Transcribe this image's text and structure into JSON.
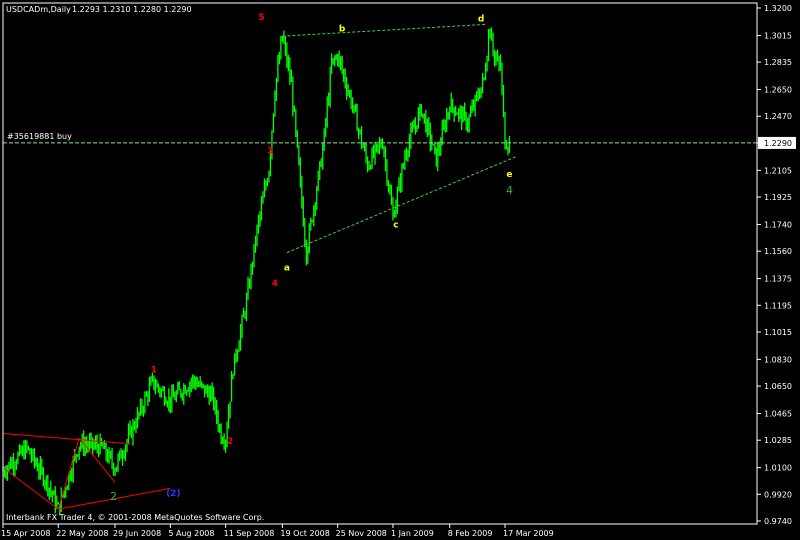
{
  "header": {
    "symbol": "USDCADm,Daily",
    "ohlc": "1.2293 1.2310 1.2280 1.2290"
  },
  "footer": {
    "copyright": "Interbank FX Trader 4, © 2001-2008 MetaQuotes Software Corp."
  },
  "order_line": {
    "label": "#35619881 buy",
    "price": 1.229,
    "color": "#8ee28e"
  },
  "current_price": {
    "label": "1.2290",
    "value": 1.229
  },
  "colors": {
    "background": "#000000",
    "candles": "#00ff00",
    "frame": "#ffffff",
    "red": "#ff0000",
    "yellow": "#ffff00",
    "wave_green": "#2db52d",
    "blue": "#1e3cff",
    "triangle_line": "#44cc44"
  },
  "chart_data": {
    "type": "line",
    "title": "USDCADm,Daily",
    "ylim": [
      0.97,
      1.32
    ],
    "y_ticks": [
      "1.3200",
      "1.3015",
      "1.2835",
      "1.2650",
      "1.2470",
      "1.2290",
      "1.2105",
      "1.1925",
      "1.1740",
      "1.1560",
      "1.1375",
      "1.1195",
      "1.1015",
      "1.0830",
      "1.0650",
      "1.0465",
      "1.0285",
      "1.0100",
      "0.9920",
      "0.9740"
    ],
    "x_ticks": [
      "15 Apr 2008",
      "22 May 2008",
      "29 Jun 2008",
      "5 Aug 2008",
      "11 Sep 2008",
      "19 Oct 2008",
      "25 Nov 2008",
      "1 Jan 2009",
      "8 Feb 2009",
      "17 Mar 2009"
    ],
    "series": [
      {
        "x": [
          "15 Apr 2008",
          "1 May 2008",
          "15 May 2008",
          "22 May 2008",
          "5 Jun 2008",
          "20 Jun 2008",
          "29 Jun 2008",
          "15 Jul 2008",
          "24 Jul 2008",
          "5 Aug 2008",
          "20 Aug 2008",
          "2 Sep 2008",
          "8 Sep 2008",
          "11 Sep 2008",
          "16 Sep 2008",
          "25 Sep 2008",
          "2 Oct 2008",
          "10 Oct 2008",
          "14 Oct 2008",
          "19 Oct 2008",
          "25 Oct 2008",
          "4 Nov 2008",
          "15 Nov 2008",
          "21 Nov 2008",
          "25 Nov 2008",
          "5 Dec 2008",
          "15 Dec 2008",
          "25 Dec 2008",
          "1 Jan 2009",
          "10 Jan 2009",
          "20 Jan 2009",
          "30 Jan 2009",
          "8 Feb 2009",
          "20 Feb 2009",
          "3 Mar 2009",
          "7 Mar 2009",
          "10 Mar 2009",
          "14 Mar 2009",
          "17 Mar 2009",
          "20 Mar 2009"
        ],
        "values": [
          1.008,
          1.023,
          0.999,
          0.982,
          1.026,
          1.024,
          1.01,
          1.046,
          1.068,
          1.055,
          1.069,
          1.058,
          1.032,
          1.03,
          1.077,
          1.122,
          1.17,
          1.212,
          1.265,
          1.301,
          1.268,
          1.155,
          1.224,
          1.282,
          1.288,
          1.254,
          1.214,
          1.23,
          1.179,
          1.225,
          1.252,
          1.218,
          1.255,
          1.243,
          1.272,
          1.309,
          1.286,
          1.28,
          1.23,
          1.229
        ]
      }
    ],
    "annotations": [
      {
        "text": "5",
        "color": "red",
        "date": "5 Oct 2008",
        "price": 1.312
      },
      {
        "text": "3",
        "color": "red",
        "date": "11 Oct 2008",
        "price": 1.222
      },
      {
        "text": "4",
        "color": "red",
        "date": "14 Oct 2008",
        "price": 1.1325
      },
      {
        "text": "1",
        "color": "red",
        "date": "25 Jul 2008",
        "price": 1.074
      },
      {
        "text": "2",
        "color": "red",
        "date": "14 Sep 2008",
        "price": 1.026
      },
      {
        "text": "b",
        "color": "yellow",
        "date": "28 Nov 2008",
        "price": 1.304
      },
      {
        "text": "a",
        "color": "yellow",
        "date": "22 Oct 2008",
        "price": 1.143
      },
      {
        "text": "c",
        "color": "yellow",
        "date": "3 Jan 2009",
        "price": 1.172
      },
      {
        "text": "d",
        "color": "yellow",
        "date": "1 Mar 2009",
        "price": 1.311
      },
      {
        "text": "e",
        "color": "yellow",
        "date": "20 Mar 2009",
        "price": 1.206
      },
      {
        "text": "4",
        "color": "green",
        "date": "20 Mar 2009",
        "price": 1.1945
      },
      {
        "text": "2",
        "color": "green",
        "date": "28 Jun 2008",
        "price": 0.988
      },
      {
        "text": "(2)",
        "color": "blue",
        "date": "7 Aug 2008",
        "price": 0.991
      }
    ],
    "trendlines": [
      {
        "color": "green-dashed",
        "from": {
          "date": "19 Oct 2008",
          "price": 1.301
        },
        "to": {
          "date": "5 Mar 2009",
          "price": 1.309
        }
      },
      {
        "color": "green-dashed",
        "from": {
          "date": "22 Oct 2008",
          "price": 1.155
        },
        "to": {
          "date": "25 Mar 2009",
          "price": 1.22
        }
      },
      {
        "color": "red",
        "from": {
          "date": "15 Apr 2008",
          "price": 1.033
        },
        "to": {
          "date": "10 Jul 2008",
          "price": 1.026
        }
      },
      {
        "color": "red",
        "from": {
          "date": "15 Apr 2008",
          "price": 1.01
        },
        "to": {
          "date": "22 May 2008",
          "price": 0.982
        }
      },
      {
        "color": "red",
        "from": {
          "date": "22 May 2008",
          "price": 0.982
        },
        "to": {
          "date": "5 Aug 2008",
          "price": 0.996
        }
      },
      {
        "color": "red",
        "from": {
          "date": "22 May 2008",
          "price": 0.982
        },
        "to": {
          "date": "5 Jun 2008",
          "price": 1.03
        }
      },
      {
        "color": "red",
        "from": {
          "date": "5 Jun 2008",
          "price": 1.03
        },
        "to": {
          "date": "29 Jun 2008",
          "price": 1.0
        }
      }
    ],
    "grid": false
  }
}
